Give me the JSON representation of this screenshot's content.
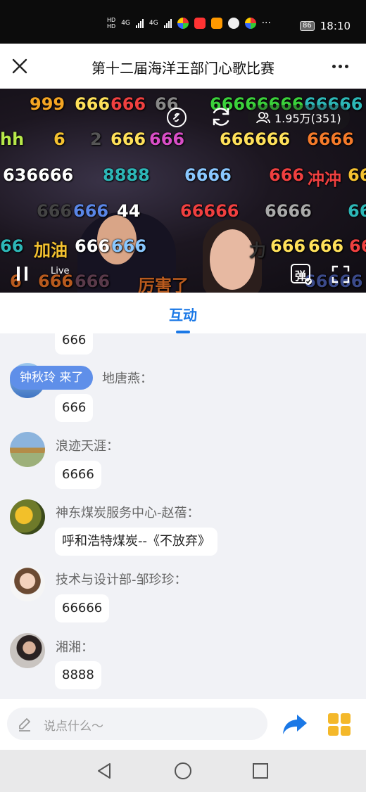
{
  "status_bar": {
    "network_1": "4G",
    "network_2": "4G",
    "more": "···",
    "battery": "86",
    "time": "18:10"
  },
  "title_bar": {
    "title": "第十二届海洋王部门心歌比赛"
  },
  "video": {
    "viewers": "1.95万(351)",
    "live_label": "Live",
    "danmaku_toggle_label": "弹",
    "danmaku": [
      "999",
      "666",
      "666",
      "66",
      "66666666",
      "66666",
      "hh",
      "6",
      "2",
      "666",
      "666",
      "666666",
      "6666",
      "636666",
      "8888",
      "6666",
      "666",
      "冲冲",
      "66",
      "666",
      "666",
      "44",
      "66666",
      "6666",
      "66",
      "66",
      "加油",
      "666",
      "666",
      "力",
      "666",
      "666",
      "66",
      "6",
      "666",
      "666",
      "厉害了",
      "66666"
    ]
  },
  "tabs": {
    "active": "互动"
  },
  "chat": {
    "join_toast": "钟秋玲 来了",
    "messages": [
      {
        "nick": "",
        "text": "666"
      },
      {
        "nick": "地唐燕：",
        "text": "666"
      },
      {
        "nick": "浪迹天涯：",
        "text": "6666"
      },
      {
        "nick": "神东煤炭服务中心-赵蓓：",
        "text": "呼和浩特煤炭--《不放弃》"
      },
      {
        "nick": "技术与设计部-邹珍珍：",
        "text": "66666"
      },
      {
        "nick": "湘湘：",
        "text": "8888"
      }
    ]
  },
  "input_bar": {
    "placeholder": "说点什么～"
  },
  "colors": {
    "accent": "#1a78e6",
    "toast": "#5f8fe9",
    "grid_icon": "#f4b82a"
  }
}
